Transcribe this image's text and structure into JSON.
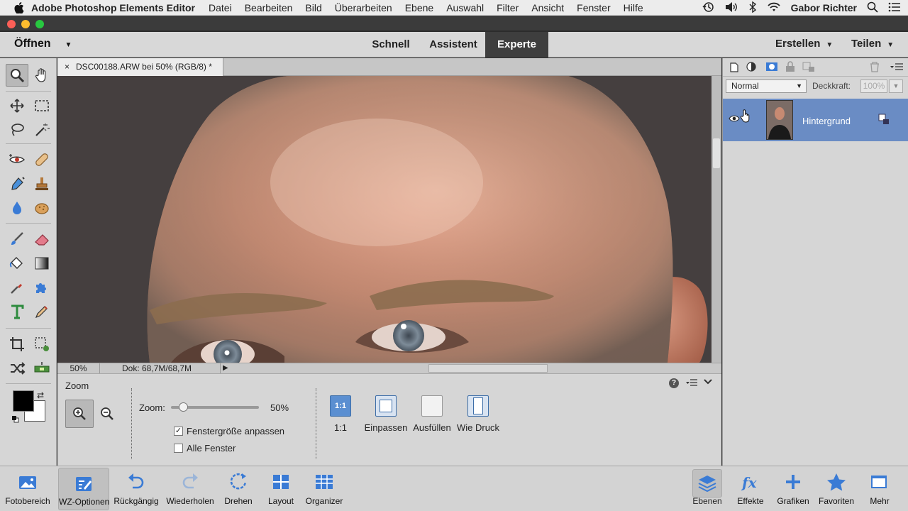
{
  "menubar": {
    "app_name": "Adobe Photoshop Elements Editor",
    "menus": [
      "Datei",
      "Bearbeiten",
      "Bild",
      "Überarbeiten",
      "Ebene",
      "Auswahl",
      "Filter",
      "Ansicht",
      "Fenster",
      "Hilfe"
    ],
    "user": "Gabor Richter"
  },
  "modebar": {
    "open_label": "Öffnen",
    "modes": [
      "Schnell",
      "Assistent",
      "Experte"
    ],
    "active_mode": "Experte",
    "create_label": "Erstellen",
    "share_label": "Teilen"
  },
  "document": {
    "tab_close": "×",
    "tab_title": "DSC00188.ARW bei 50% (RGB/8) *",
    "zoom_status": "50%",
    "doc_status": "Dok: 68,7M/68,7M"
  },
  "tool_options": {
    "title": "Zoom",
    "zoom_label": "Zoom:",
    "zoom_value": "50%",
    "zoom_fraction": 0.14,
    "resize_windows_label": "Fenstergröße anpassen",
    "resize_windows_checked": true,
    "all_windows_label": "Alle Fenster",
    "all_windows_checked": false,
    "view_buttons": [
      {
        "icon_text": "1:1",
        "label": "1:1"
      },
      {
        "icon_text": "",
        "label": "Einpassen"
      },
      {
        "icon_text": "",
        "label": "Ausfüllen"
      },
      {
        "icon_text": "",
        "label": "Wie Druck"
      }
    ]
  },
  "layers_panel": {
    "blend_mode": "Normal",
    "opacity_label": "Deckkraft:",
    "opacity_value": "100%",
    "layers": [
      {
        "name": "Hintergrund",
        "visible": true,
        "locked": true
      }
    ]
  },
  "bottom_bar": {
    "left": [
      "Fotobereich",
      "WZ-Optionen",
      "Rückgängig",
      "Wiederholen",
      "Drehen",
      "Layout",
      "Organizer"
    ],
    "right": [
      "Ebenen",
      "Effekte",
      "Grafiken",
      "Favoriten",
      "Mehr"
    ]
  },
  "colors": {
    "accent": "#3e6db5",
    "active_mode_bg": "#3e3e3e",
    "layer_selected": "#6a8cc4",
    "foreground_color": "#000000",
    "background_color": "#ffffff"
  }
}
